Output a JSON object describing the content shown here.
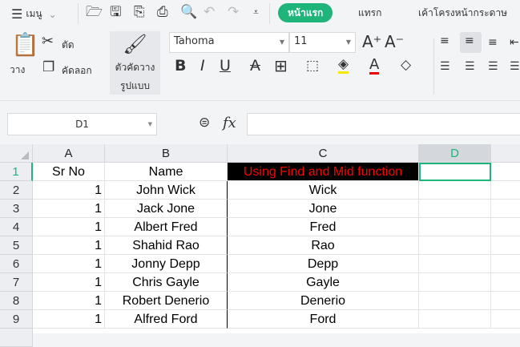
{
  "menu": {
    "label": "เมนู"
  },
  "tabs": [
    {
      "label": "หน้าแรก",
      "active": true
    },
    {
      "label": "แทรก"
    },
    {
      "label": "เค้าโครงหน้ากระดาษ"
    }
  ],
  "ribbon": {
    "paste": "วาง",
    "cut": "ตัด",
    "copy": "คัดลอก",
    "format_painter": [
      "ตัวคัดวาง",
      "รูปแบบ"
    ],
    "font": "Tahoma",
    "size": "11"
  },
  "namebox": "D1",
  "fx": "fx",
  "columns": [
    "A",
    "B",
    "C",
    "D"
  ],
  "rows": [
    {
      "n": "1",
      "a": "Sr No",
      "b": "Name",
      "c": "Using Find and Mid function"
    },
    {
      "n": "2",
      "a": "1",
      "b": "John Wick",
      "c": "Wick"
    },
    {
      "n": "3",
      "a": "1",
      "b": "Jack Jone",
      "c": "Jone"
    },
    {
      "n": "4",
      "a": "1",
      "b": "Albert Fred",
      "c": "Fred"
    },
    {
      "n": "5",
      "a": "1",
      "b": "Shahid Rao",
      "c": "Rao"
    },
    {
      "n": "6",
      "a": "1",
      "b": "Jonny Depp",
      "c": "Depp"
    },
    {
      "n": "7",
      "a": "1",
      "b": "Chris Gayle",
      "c": "Gayle"
    },
    {
      "n": "8",
      "a": "1",
      "b": "Robert Denerio",
      "c": "Denerio"
    },
    {
      "n": "9",
      "a": "1",
      "b": "Alfred Ford",
      "c": "Ford"
    }
  ],
  "colors": {
    "accent": "#1fb47a",
    "header_bg": "#000000",
    "header_fg": "#ff0000"
  }
}
